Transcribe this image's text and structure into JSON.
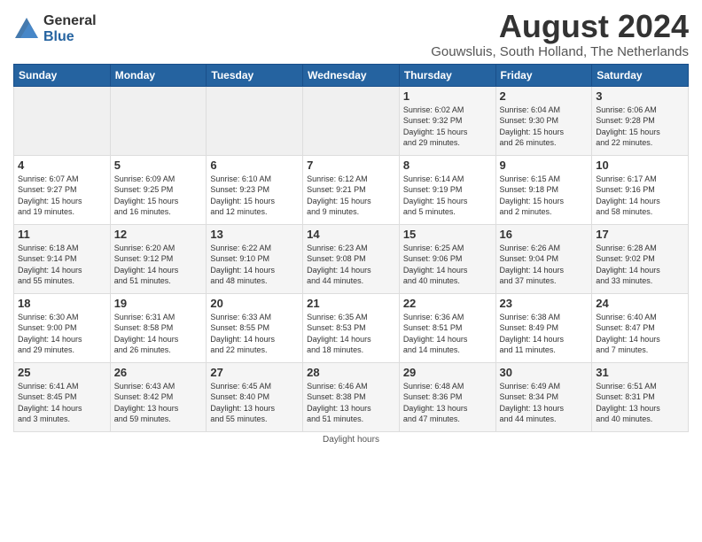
{
  "header": {
    "logo_general": "General",
    "logo_blue": "Blue",
    "month_year": "August 2024",
    "location": "Gouwsluis, South Holland, The Netherlands"
  },
  "days_of_week": [
    "Sunday",
    "Monday",
    "Tuesday",
    "Wednesday",
    "Thursday",
    "Friday",
    "Saturday"
  ],
  "weeks": [
    [
      {
        "day": "",
        "info": ""
      },
      {
        "day": "",
        "info": ""
      },
      {
        "day": "",
        "info": ""
      },
      {
        "day": "",
        "info": ""
      },
      {
        "day": "1",
        "info": "Sunrise: 6:02 AM\nSunset: 9:32 PM\nDaylight: 15 hours\nand 29 minutes."
      },
      {
        "day": "2",
        "info": "Sunrise: 6:04 AM\nSunset: 9:30 PM\nDaylight: 15 hours\nand 26 minutes."
      },
      {
        "day": "3",
        "info": "Sunrise: 6:06 AM\nSunset: 9:28 PM\nDaylight: 15 hours\nand 22 minutes."
      }
    ],
    [
      {
        "day": "4",
        "info": "Sunrise: 6:07 AM\nSunset: 9:27 PM\nDaylight: 15 hours\nand 19 minutes."
      },
      {
        "day": "5",
        "info": "Sunrise: 6:09 AM\nSunset: 9:25 PM\nDaylight: 15 hours\nand 16 minutes."
      },
      {
        "day": "6",
        "info": "Sunrise: 6:10 AM\nSunset: 9:23 PM\nDaylight: 15 hours\nand 12 minutes."
      },
      {
        "day": "7",
        "info": "Sunrise: 6:12 AM\nSunset: 9:21 PM\nDaylight: 15 hours\nand 9 minutes."
      },
      {
        "day": "8",
        "info": "Sunrise: 6:14 AM\nSunset: 9:19 PM\nDaylight: 15 hours\nand 5 minutes."
      },
      {
        "day": "9",
        "info": "Sunrise: 6:15 AM\nSunset: 9:18 PM\nDaylight: 15 hours\nand 2 minutes."
      },
      {
        "day": "10",
        "info": "Sunrise: 6:17 AM\nSunset: 9:16 PM\nDaylight: 14 hours\nand 58 minutes."
      }
    ],
    [
      {
        "day": "11",
        "info": "Sunrise: 6:18 AM\nSunset: 9:14 PM\nDaylight: 14 hours\nand 55 minutes."
      },
      {
        "day": "12",
        "info": "Sunrise: 6:20 AM\nSunset: 9:12 PM\nDaylight: 14 hours\nand 51 minutes."
      },
      {
        "day": "13",
        "info": "Sunrise: 6:22 AM\nSunset: 9:10 PM\nDaylight: 14 hours\nand 48 minutes."
      },
      {
        "day": "14",
        "info": "Sunrise: 6:23 AM\nSunset: 9:08 PM\nDaylight: 14 hours\nand 44 minutes."
      },
      {
        "day": "15",
        "info": "Sunrise: 6:25 AM\nSunset: 9:06 PM\nDaylight: 14 hours\nand 40 minutes."
      },
      {
        "day": "16",
        "info": "Sunrise: 6:26 AM\nSunset: 9:04 PM\nDaylight: 14 hours\nand 37 minutes."
      },
      {
        "day": "17",
        "info": "Sunrise: 6:28 AM\nSunset: 9:02 PM\nDaylight: 14 hours\nand 33 minutes."
      }
    ],
    [
      {
        "day": "18",
        "info": "Sunrise: 6:30 AM\nSunset: 9:00 PM\nDaylight: 14 hours\nand 29 minutes."
      },
      {
        "day": "19",
        "info": "Sunrise: 6:31 AM\nSunset: 8:58 PM\nDaylight: 14 hours\nand 26 minutes."
      },
      {
        "day": "20",
        "info": "Sunrise: 6:33 AM\nSunset: 8:55 PM\nDaylight: 14 hours\nand 22 minutes."
      },
      {
        "day": "21",
        "info": "Sunrise: 6:35 AM\nSunset: 8:53 PM\nDaylight: 14 hours\nand 18 minutes."
      },
      {
        "day": "22",
        "info": "Sunrise: 6:36 AM\nSunset: 8:51 PM\nDaylight: 14 hours\nand 14 minutes."
      },
      {
        "day": "23",
        "info": "Sunrise: 6:38 AM\nSunset: 8:49 PM\nDaylight: 14 hours\nand 11 minutes."
      },
      {
        "day": "24",
        "info": "Sunrise: 6:40 AM\nSunset: 8:47 PM\nDaylight: 14 hours\nand 7 minutes."
      }
    ],
    [
      {
        "day": "25",
        "info": "Sunrise: 6:41 AM\nSunset: 8:45 PM\nDaylight: 14 hours\nand 3 minutes."
      },
      {
        "day": "26",
        "info": "Sunrise: 6:43 AM\nSunset: 8:42 PM\nDaylight: 13 hours\nand 59 minutes."
      },
      {
        "day": "27",
        "info": "Sunrise: 6:45 AM\nSunset: 8:40 PM\nDaylight: 13 hours\nand 55 minutes."
      },
      {
        "day": "28",
        "info": "Sunrise: 6:46 AM\nSunset: 8:38 PM\nDaylight: 13 hours\nand 51 minutes."
      },
      {
        "day": "29",
        "info": "Sunrise: 6:48 AM\nSunset: 8:36 PM\nDaylight: 13 hours\nand 47 minutes."
      },
      {
        "day": "30",
        "info": "Sunrise: 6:49 AM\nSunset: 8:34 PM\nDaylight: 13 hours\nand 44 minutes."
      },
      {
        "day": "31",
        "info": "Sunrise: 6:51 AM\nSunset: 8:31 PM\nDaylight: 13 hours\nand 40 minutes."
      }
    ]
  ],
  "footer": "Daylight hours"
}
